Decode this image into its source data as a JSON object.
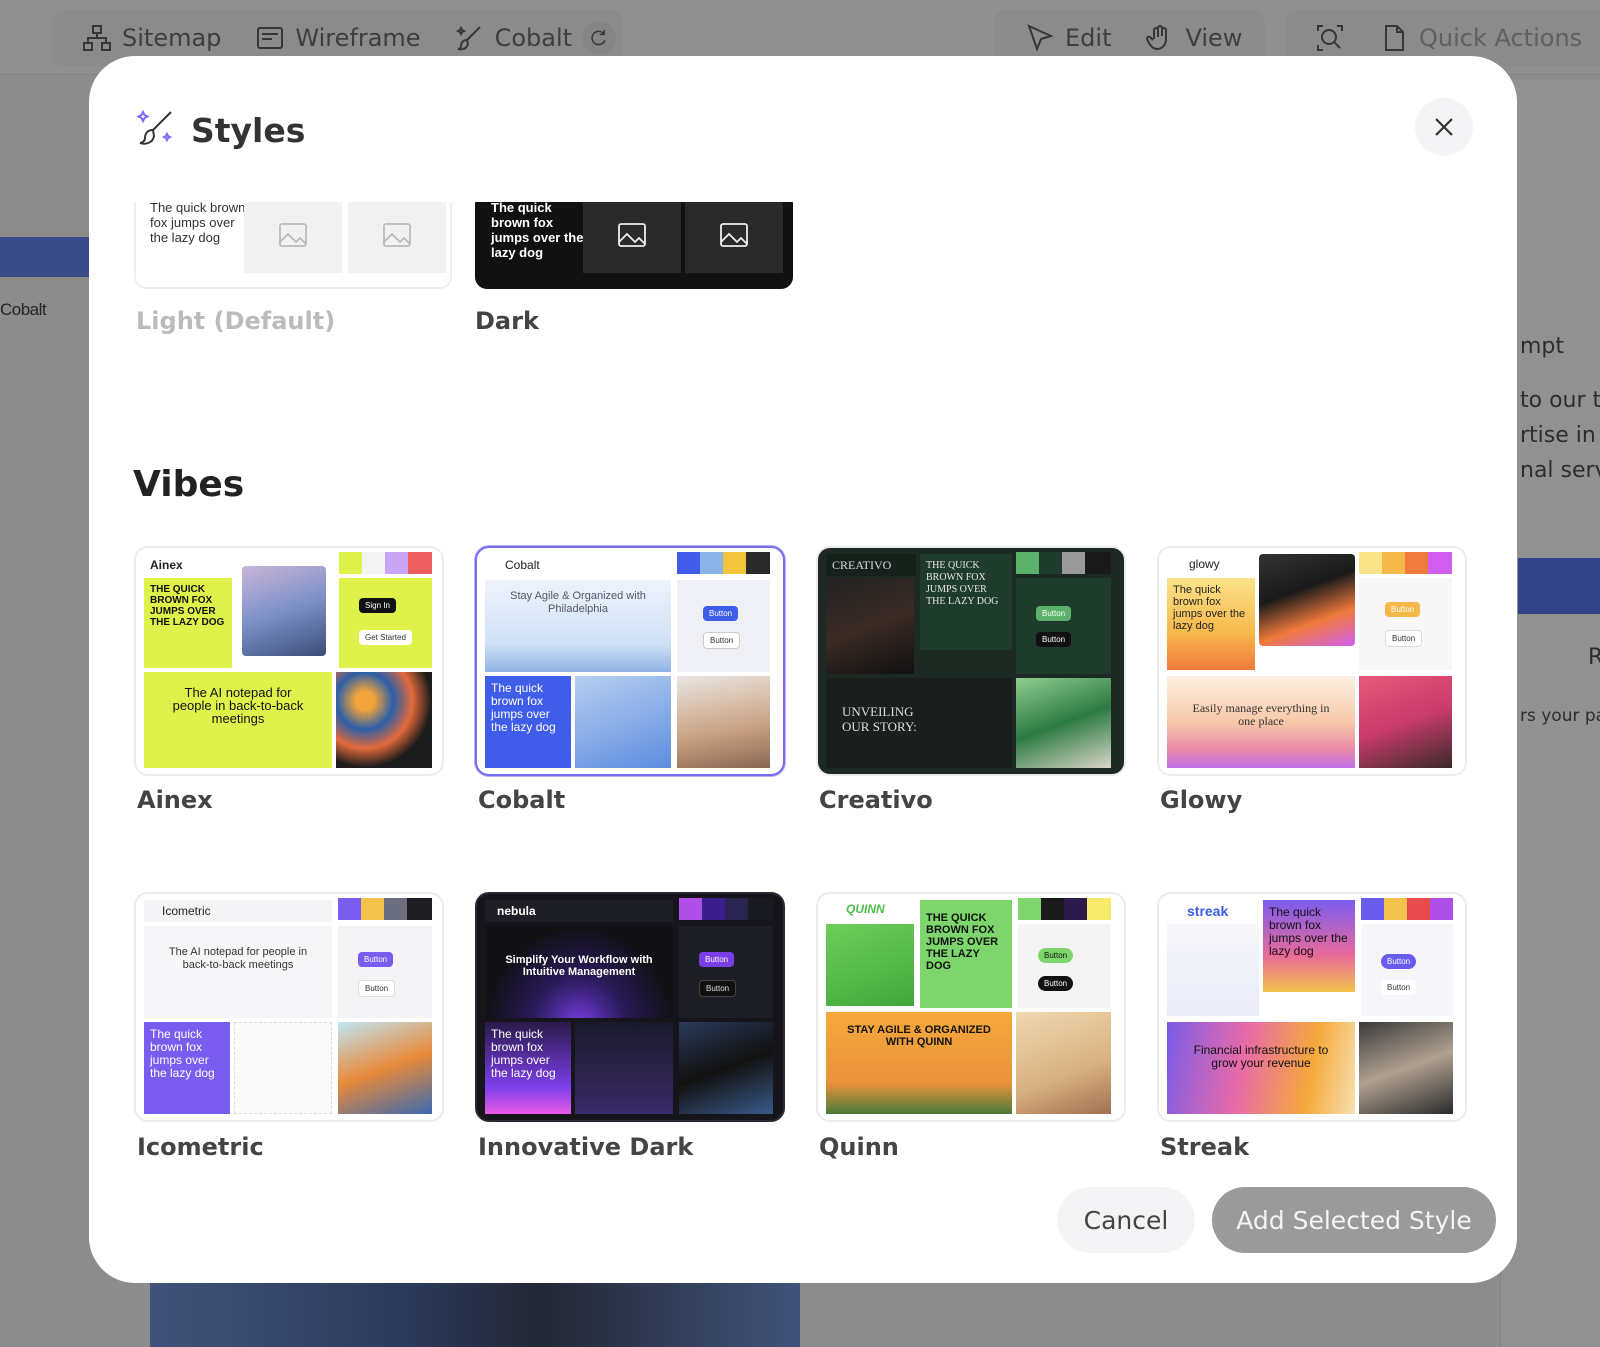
{
  "toolbar": {
    "sitemap": "Sitemap",
    "wireframe": "Wireframe",
    "cobalt": "Cobalt",
    "edit": "Edit",
    "view": "View",
    "quick_actions": "Quick Actions"
  },
  "background": {
    "canvas_tag": "Cobalt",
    "side_prompt": "mpt",
    "side_line1": "to our t",
    "side_line2": "rtise in f",
    "side_line3": "nal serv",
    "side_r": "R",
    "side_line4": "rs your pa"
  },
  "modal": {
    "title": "Styles",
    "themes": [
      {
        "label": "Light (Default)",
        "preview_text": "The quick brown fox jumps over the lazy dog"
      },
      {
        "label": "Dark",
        "preview_text": "The quick brown fox jumps over the lazy dog"
      }
    ],
    "vibes_title": "Vibes",
    "vibes": [
      {
        "label": "Ainex",
        "logo": "Ainex",
        "headline": "THE QUICK BROWN FOX JUMPS OVER THE LAZY DOG",
        "sub": "The AI notepad for people in back-to-back meetings",
        "btn1": "Sign In",
        "btn2": "Get Started",
        "swatches": [
          "#dff24b",
          "#f4f4f4",
          "#c9a6f5",
          "#f05f5f"
        ]
      },
      {
        "label": "Cobalt",
        "logo": "Cobalt",
        "headline": "Stay Agile & Organized with Philadelphia",
        "sub": "The quick brown fox jumps over the lazy dog",
        "btn1": "Button",
        "btn2": "Button",
        "swatches": [
          "#3f5de8",
          "#8ab4e8",
          "#f2c53d",
          "#2a2a2a"
        ]
      },
      {
        "label": "Creativo",
        "logo": "CREATIVO",
        "headline": "THE QUICK BROWN FOX JUMPS OVER THE LAZY DOG",
        "sub": "UNVEILING OUR STORY:",
        "btn1": "Button",
        "btn2": "Button",
        "swatches": [
          "#5bb06a",
          "#1f3b2c",
          "#9a9a9a",
          "#1a1a1a"
        ]
      },
      {
        "label": "Glowy",
        "logo": "glowy",
        "headline": "The quick brown fox jumps over the lazy dog",
        "sub": "Easily manage everything in one place",
        "btn1": "Button",
        "btn2": "Button",
        "swatches": [
          "#fbe38a",
          "#f7b84b",
          "#f07a3b",
          "#d05ef0"
        ]
      },
      {
        "label": "Icometric",
        "logo": "Icometric",
        "headline": "The quick brown fox jumps over the lazy dog",
        "sub": "The AI notepad for people in back-to-back meetings",
        "btn1": "Button",
        "btn2": "Button",
        "swatches": [
          "#7b5cf0",
          "#f2c24b",
          "#6b6f80",
          "#1e1e22"
        ]
      },
      {
        "label": "Innovative Dark",
        "logo": "nebula",
        "headline": "The quick brown fox jumps over the lazy dog",
        "sub": "Simplify Your Workflow with Intuitive Management",
        "btn1": "Button",
        "btn2": "Button",
        "swatches": [
          "#b04ee8",
          "#3b1e8c",
          "#2a2550",
          "#1a1a22"
        ]
      },
      {
        "label": "Quinn",
        "logo": "QUINN",
        "headline": "THE QUICK BROWN FOX JUMPS OVER THE LAZY DOG",
        "sub": "STAY AGILE & ORGANIZED WITH QUINN",
        "btn1": "Button",
        "btn2": "Button",
        "swatches": [
          "#7dd56b",
          "#1a1a1a",
          "#2e1a4a",
          "#f7ea6b"
        ]
      },
      {
        "label": "Streak",
        "logo": "streak",
        "headline": "The quick brown fox jumps over the lazy dog",
        "sub": "Financial infrastructure to grow your revenue",
        "btn1": "Button",
        "btn2": "Button",
        "swatches": [
          "#6b5cf0",
          "#f2c24b",
          "#e84b4b",
          "#b04ee8"
        ]
      }
    ],
    "cancel": "Cancel",
    "add": "Add Selected Style"
  }
}
